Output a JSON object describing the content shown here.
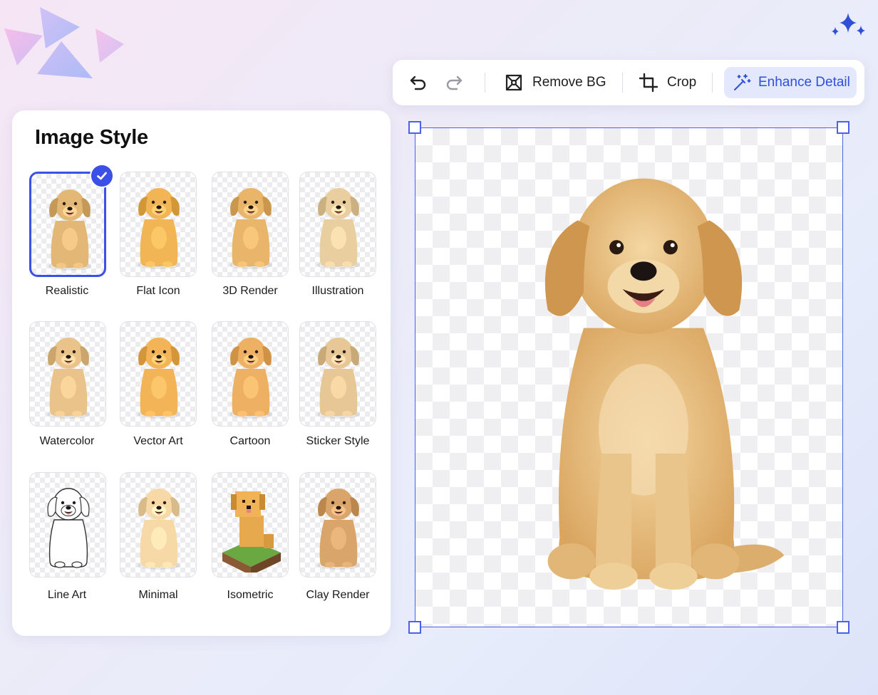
{
  "panel": {
    "title": "Image Style",
    "styles": [
      {
        "label": "Realistic",
        "selected": true,
        "fur": "#e3b877"
      },
      {
        "label": "Flat Icon",
        "selected": false,
        "fur": "#f1b555"
      },
      {
        "label": "3D Render",
        "selected": false,
        "fur": "#e8b56a"
      },
      {
        "label": "Illustration",
        "selected": false,
        "fur": "#e9cf9f"
      },
      {
        "label": "Watercolor",
        "selected": false,
        "fur": "#e9c38a"
      },
      {
        "label": "Vector Art",
        "selected": false,
        "fur": "#f3b457"
      },
      {
        "label": "Cartoon",
        "selected": false,
        "fur": "#eeb062"
      },
      {
        "label": "Sticker Style",
        "selected": false,
        "fur": "#e6c795"
      },
      {
        "label": "Line Art",
        "selected": false,
        "fur": "#ffffff"
      },
      {
        "label": "Minimal",
        "selected": false,
        "fur": "#f6d9a6"
      },
      {
        "label": "Isometric",
        "selected": false,
        "fur": "#e7a94d"
      },
      {
        "label": "Clay Render",
        "selected": false,
        "fur": "#d9a56a"
      }
    ]
  },
  "toolbar": {
    "undo_icon": "undo-icon",
    "redo_icon": "redo-icon",
    "remove_bg": "Remove BG",
    "crop": "Crop",
    "enhance": "Enhance Detail"
  },
  "colors": {
    "accent": "#3b50e6",
    "enhance_bg": "#e3e8fd",
    "dog_fur": "#e6bc7c"
  }
}
